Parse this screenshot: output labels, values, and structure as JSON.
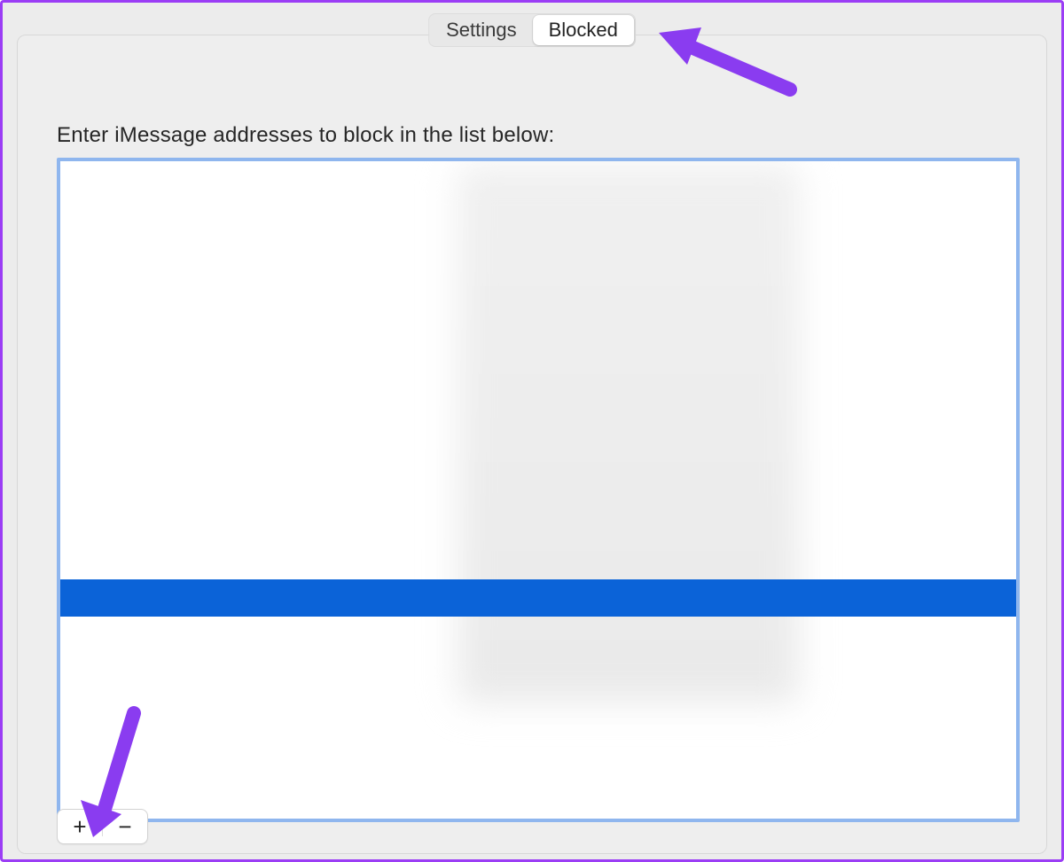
{
  "tabs": {
    "settings": "Settings",
    "blocked": "Blocked",
    "active": "blocked"
  },
  "instruction": "Enter iMessage addresses to block in the list below:",
  "buttons": {
    "add": "+",
    "remove": "−"
  },
  "annotation_color": "#8a3cf0"
}
